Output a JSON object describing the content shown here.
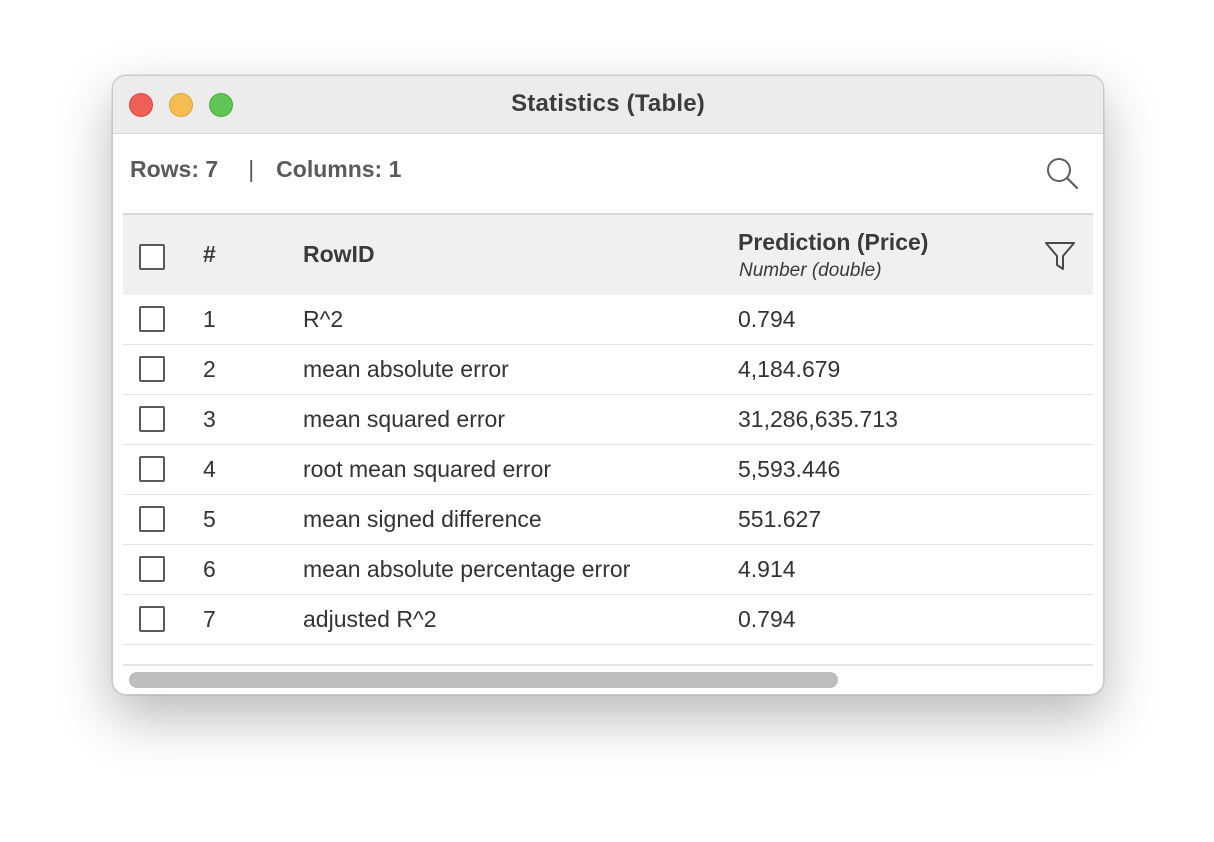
{
  "window": {
    "title": "Statistics (Table)"
  },
  "info": {
    "rows_label": "Rows: 7",
    "separator": "|",
    "columns_label": "Columns: 1"
  },
  "table": {
    "headers": {
      "num": "#",
      "rowid": "RowID",
      "column_name": "Prediction (Price)",
      "column_type": "Number (double)"
    },
    "rows": [
      {
        "num": "1",
        "rowid": "R^2",
        "value": "0.794"
      },
      {
        "num": "2",
        "rowid": "mean absolute error",
        "value": "4,184.679"
      },
      {
        "num": "3",
        "rowid": "mean squared error",
        "value": "31,286,635.713"
      },
      {
        "num": "4",
        "rowid": "root mean squared error",
        "value": "5,593.446"
      },
      {
        "num": "5",
        "rowid": "mean signed difference",
        "value": "551.627"
      },
      {
        "num": "6",
        "rowid": "mean absolute percentage error",
        "value": "4.914"
      },
      {
        "num": "7",
        "rowid": "adjusted R^2",
        "value": "0.794"
      }
    ]
  },
  "icons": {
    "search": "search-icon",
    "filter": "filter-icon"
  },
  "colors": {
    "close": "#ee5f57",
    "minimize": "#f5bd4f",
    "maximize": "#61c454",
    "header_bg": "#eff0f2"
  }
}
